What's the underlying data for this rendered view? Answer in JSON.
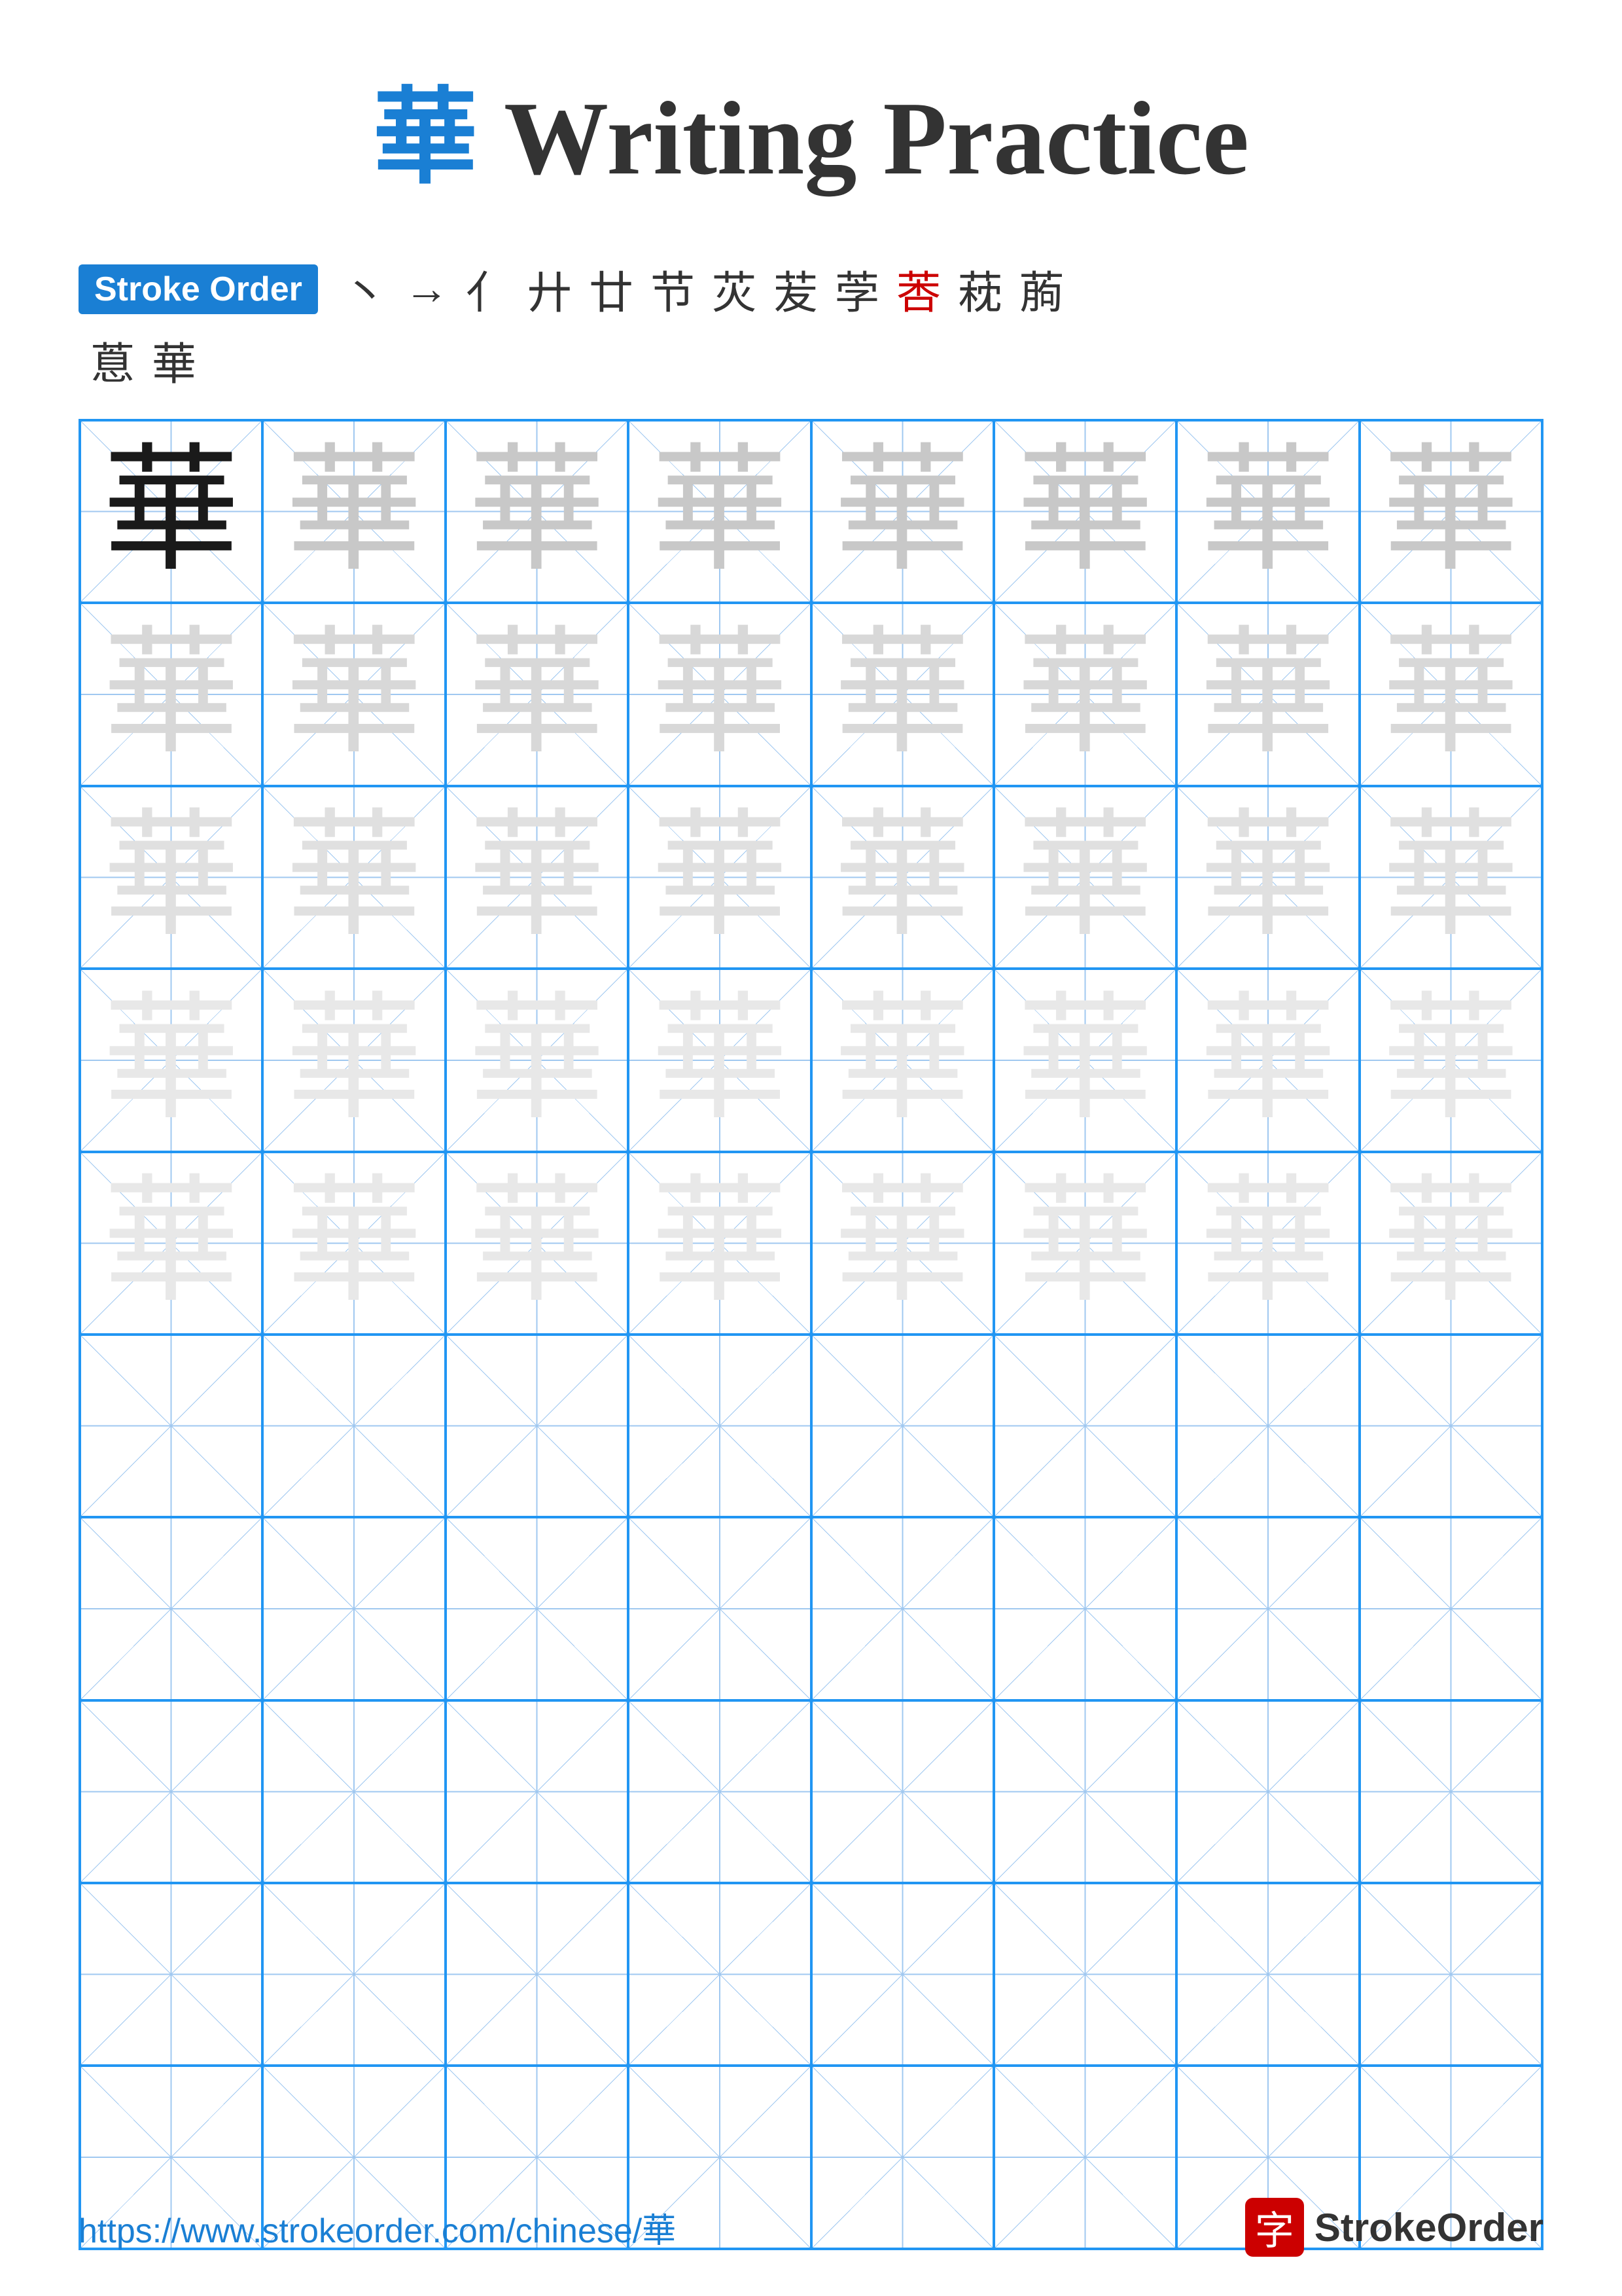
{
  "title": {
    "char": "華",
    "rest": " Writing Practice"
  },
  "stroke_order": {
    "badge_label": "Stroke Order",
    "steps": [
      "丶",
      "一",
      "亻",
      "廾",
      "廿",
      "节",
      "苂",
      "苃",
      "茡",
      "莕",
      "萙",
      "葋",
      "蒠",
      "華"
    ]
  },
  "grid": {
    "char": "華",
    "rows": 10,
    "cols": 8,
    "shading": [
      [
        "dark",
        "medium",
        "medium",
        "medium",
        "medium",
        "medium",
        "medium",
        "medium"
      ],
      [
        "light",
        "light",
        "light",
        "light",
        "light",
        "light",
        "light",
        "light"
      ],
      [
        "lighter",
        "lighter",
        "lighter",
        "lighter",
        "lighter",
        "lighter",
        "lighter",
        "lighter"
      ],
      [
        "lightest",
        "lightest",
        "lightest",
        "lightest",
        "lightest",
        "lightest",
        "lightest",
        "lightest"
      ],
      [
        "lightest",
        "lightest",
        "lightest",
        "lightest",
        "lightest",
        "lightest",
        "lightest",
        "lightest"
      ],
      [
        "empty",
        "empty",
        "empty",
        "empty",
        "empty",
        "empty",
        "empty",
        "empty"
      ],
      [
        "empty",
        "empty",
        "empty",
        "empty",
        "empty",
        "empty",
        "empty",
        "empty"
      ],
      [
        "empty",
        "empty",
        "empty",
        "empty",
        "empty",
        "empty",
        "empty",
        "empty"
      ],
      [
        "empty",
        "empty",
        "empty",
        "empty",
        "empty",
        "empty",
        "empty",
        "empty"
      ],
      [
        "empty",
        "empty",
        "empty",
        "empty",
        "empty",
        "empty",
        "empty",
        "empty"
      ]
    ]
  },
  "footer": {
    "url": "https://www.strokeorder.com/chinese/華",
    "logo_char": "字",
    "logo_text": "StrokeOrder"
  }
}
